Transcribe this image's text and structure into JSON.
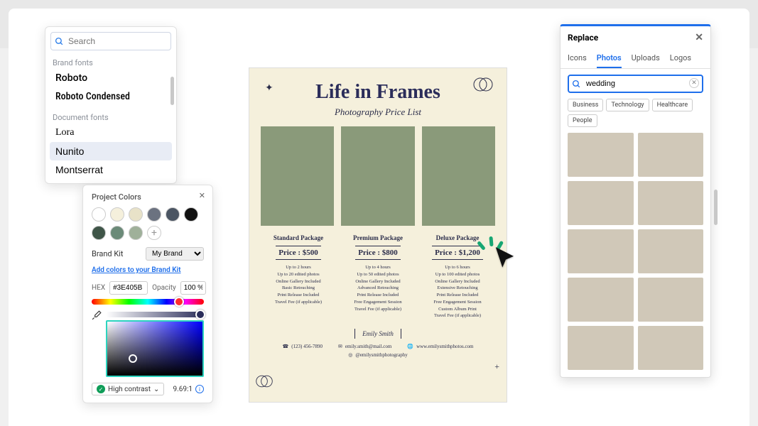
{
  "font_panel": {
    "search_placeholder": "Search",
    "section_brand": "Brand fonts",
    "section_doc": "Document fonts",
    "brand_fonts": [
      "Roboto",
      "Roboto Condensed"
    ],
    "doc_fonts": [
      "Lora",
      "Nunito",
      "Montserrat"
    ],
    "selected": "Nunito"
  },
  "color_panel": {
    "title": "Project Colors",
    "swatches_row1": [
      "#ffffff",
      "#f5f0dc",
      "#e8e2c8",
      "#6b7280",
      "#4b5563",
      "#111111"
    ],
    "swatches_row2": [
      "#3f5548",
      "#6b8a78",
      "#9fb09a"
    ],
    "brand_label": "Brand Kit",
    "brand_value": "My Brand",
    "brand_link": "Add colors to your Brand Kit",
    "hex_label": "HEX",
    "hex_value": "#3E405B",
    "opacity_label": "Opacity",
    "opacity_value": "100 %",
    "contrast_label": "High contrast",
    "contrast_ratio": "9.69:1"
  },
  "document": {
    "title": "Life in Frames",
    "subtitle": "Photography Price List",
    "packages": [
      {
        "name": "Standard Package",
        "price": "Price : $500",
        "features": [
          "Up to 2 hours",
          "Up to 20 edited photos",
          "Online Gallery Included",
          "Basic Retouching",
          "Print Release Included",
          "Travel Fee (if applicable)"
        ]
      },
      {
        "name": "Premium Package",
        "price": "Price : $800",
        "features": [
          "Up to 4 hours",
          "Up to 50 edited photos",
          "Online Gallery Included",
          "Advanced Retouching",
          "Print Release Included",
          "Free Engagement Session",
          "Travel Fee (if applicable)"
        ]
      },
      {
        "name": "Deluxe Package",
        "price": "Price : $1,200",
        "features": [
          "Up to 6 hours",
          "Up to 100 edited photos",
          "Online Gallery Included",
          "Extensive Retouching",
          "Print Release Included",
          "Free Engagement Session",
          "Custom Album Print",
          "Travel Fee (if applicable)"
        ]
      }
    ],
    "author": "Emily Smith",
    "contacts": {
      "phone": "(123) 456-7890",
      "email": "emily.smith@mail.com",
      "web": "www.emilysmithphotos.com",
      "social": "@emilysmithphotography"
    }
  },
  "replace_panel": {
    "title": "Replace",
    "tabs": [
      "Icons",
      "Photos",
      "Uploads",
      "Logos"
    ],
    "active_tab": "Photos",
    "search_value": "wedding",
    "chips": [
      "Business",
      "Technology",
      "Healthcare",
      "People"
    ]
  }
}
